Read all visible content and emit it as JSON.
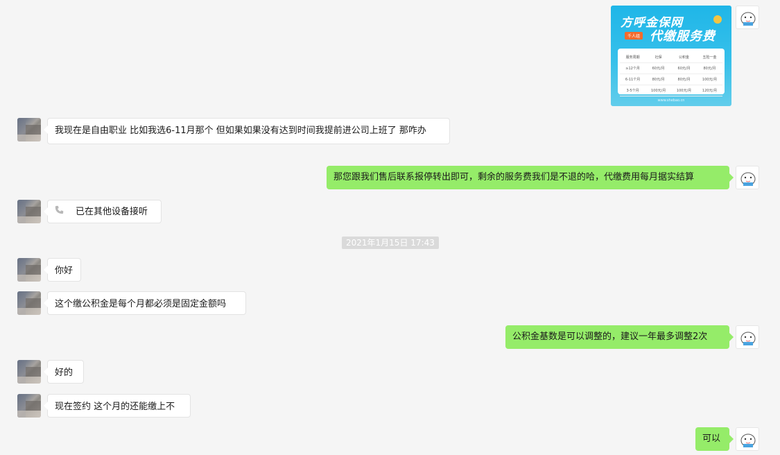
{
  "promo_image": {
    "title_line1": "方呼金保网",
    "title_line2": "代缴服务费",
    "tag": "千人组",
    "table": {
      "headers": [
        "服务周期",
        "社保",
        "公积金",
        "五险一金"
      ],
      "rows": [
        [
          "≥12个月",
          "60元/月",
          "60元/月",
          "80元/月"
        ],
        [
          "6-11个月",
          "80元/月",
          "80元/月",
          "100元/月"
        ],
        [
          "3-5个月",
          "100元/月",
          "100元/月",
          "120元/月"
        ]
      ]
    },
    "footer": "www.shebao.cn"
  },
  "messages": [
    {
      "side": "left",
      "text": "我现在是自由职业 比如我选6-11月那个 但如果如果没有达到时间我提前进公司上班了 那咋办"
    },
    {
      "side": "right",
      "text": "那您跟我们售后联系报停转出即可，剩余的服务费我们是不退的哈，代缴费用每月据实结算"
    },
    {
      "side": "left",
      "text": "已在其他设备接听",
      "icon": "phone-icon"
    },
    {
      "side": "left",
      "text": "你好"
    },
    {
      "side": "left",
      "text": "这个缴公积金是每个月都必须是固定金额吗"
    },
    {
      "side": "right",
      "text": "公积金基数是可以调整的，建议一年最多调整2次"
    },
    {
      "side": "left",
      "text": "好的"
    },
    {
      "side": "left",
      "text": "现在签约 这个月的还能缴上不"
    },
    {
      "side": "right",
      "text": "可以"
    }
  ],
  "timestamp": "2021年1月15日 17:43",
  "colors": {
    "sent_bubble": "#95ec69",
    "received_bubble": "#ffffff",
    "background": "#f5f5f5"
  }
}
